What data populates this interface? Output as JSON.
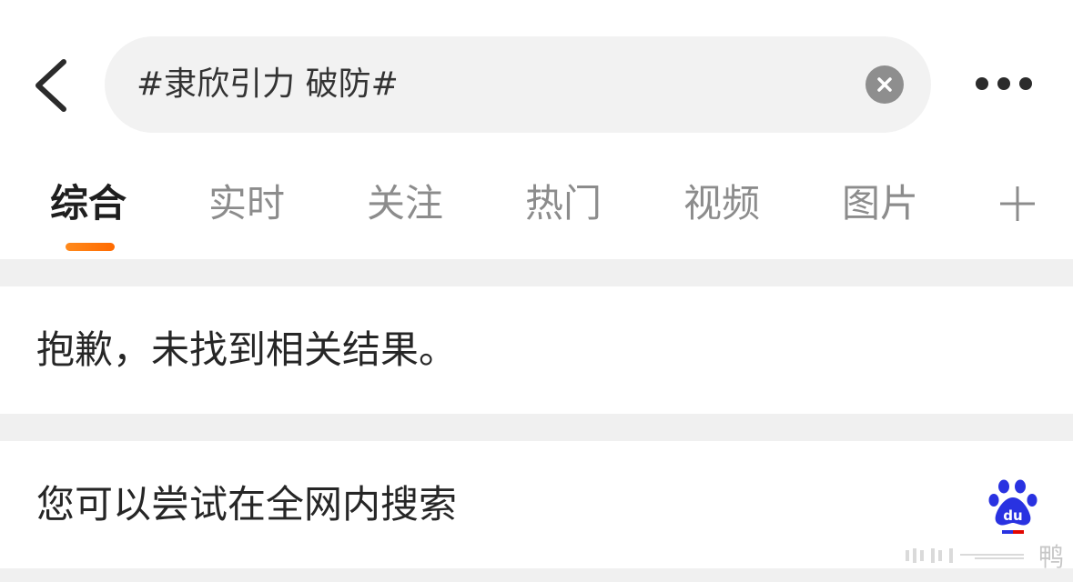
{
  "search": {
    "query": "#隶欣引力 破防#"
  },
  "tabs": [
    {
      "label": "综合",
      "active": true
    },
    {
      "label": "实时",
      "active": false
    },
    {
      "label": "关注",
      "active": false
    },
    {
      "label": "热门",
      "active": false
    },
    {
      "label": "视频",
      "active": false
    },
    {
      "label": "图片",
      "active": false
    }
  ],
  "icons": {
    "back": "chevron-left-icon",
    "clear": "clear-icon",
    "more": "more-horizontal-icon",
    "add": "plus-icon",
    "baidu": "baidu-logo-icon"
  },
  "results": {
    "not_found_message": "抱歉，未找到相关结果。",
    "web_search_prompt": "您可以尝试在全网内搜索"
  },
  "watermark": {
    "text": "鸭"
  },
  "colors": {
    "accent": "#ff7a0e",
    "baidu_blue": "#2932e1",
    "baidu_red": "#e10601",
    "separator": "#f0f0f0",
    "search_bg": "#f2f2f2"
  }
}
